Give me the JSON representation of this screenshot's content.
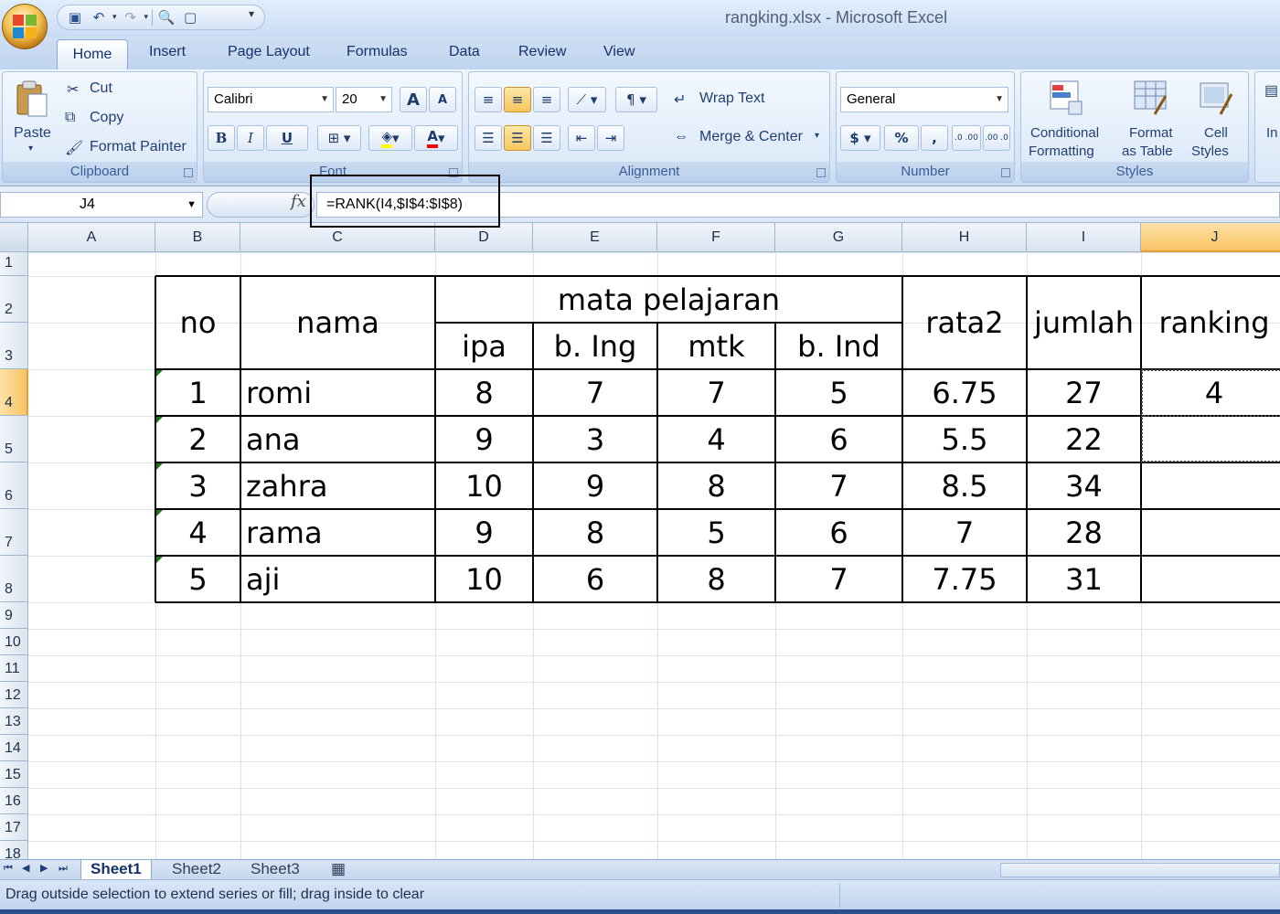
{
  "window": {
    "title": "rangking.xlsx - Microsoft Excel"
  },
  "quick_access": {
    "icons": [
      "save-icon",
      "undo-icon",
      "redo-icon",
      "print-preview-icon",
      "new-icon"
    ]
  },
  "ribbon_tabs": [
    "Home",
    "Insert",
    "Page Layout",
    "Formulas",
    "Data",
    "Review",
    "View"
  ],
  "clipboard": {
    "paste": "Paste",
    "cut": "Cut",
    "copy": "Copy",
    "format_painter": "Format Painter",
    "group": "Clipboard"
  },
  "font": {
    "name": "Calibri",
    "size": "20",
    "grow": "A",
    "shrink": "A",
    "bold": "B",
    "italic": "I",
    "underline": "U",
    "group": "Font",
    "fill_color": "#ffff00",
    "font_color": "#ff0000"
  },
  "alignment": {
    "wrap": "Wrap Text",
    "merge": "Merge & Center",
    "group": "Alignment"
  },
  "number": {
    "format": "General",
    "currency": "$",
    "percent": "%",
    "comma": ",",
    "inc_decimal": ".0 .00",
    "dec_decimal": ".00 .0",
    "group": "Number"
  },
  "styles": {
    "conditional_1": "Conditional",
    "conditional_2": "Formatting",
    "format_table_1": "Format",
    "format_table_2": "as Table",
    "cell_styles_1": "Cell",
    "cell_styles_2": "Styles",
    "group": "Styles"
  },
  "cells": {
    "insert": "In"
  },
  "formula_bar": {
    "name_box": "J4",
    "fx": "fx",
    "formula": "=RANK(I4,$I$4:$I$8)"
  },
  "columns": [
    "A",
    "B",
    "C",
    "D",
    "E",
    "F",
    "G",
    "H",
    "I",
    "J"
  ],
  "rows": [
    "1",
    "2",
    "3",
    "4",
    "5",
    "6",
    "7",
    "8",
    "9",
    "10",
    "11",
    "12",
    "13",
    "14",
    "15",
    "16",
    "17",
    "18"
  ],
  "table": {
    "headers": {
      "no": "no",
      "nama": "nama",
      "mata_pelajaran": "mata pelajaran",
      "rata2": "rata2",
      "jumlah": "jumlah",
      "ranking": "ranking"
    },
    "subjects": [
      "ipa",
      "b. Ing",
      "mtk",
      "b. Ind"
    ],
    "data": [
      [
        "1",
        "romi",
        "8",
        "7",
        "7",
        "5",
        "6.75",
        "27",
        "4"
      ],
      [
        "2",
        "ana",
        "9",
        "3",
        "4",
        "6",
        "5.5",
        "22",
        ""
      ],
      [
        "3",
        "zahra",
        "10",
        "9",
        "8",
        "7",
        "8.5",
        "34",
        ""
      ],
      [
        "4",
        "rama",
        "9",
        "8",
        "5",
        "6",
        "7",
        "28",
        ""
      ],
      [
        "5",
        "aji",
        "10",
        "6",
        "8",
        "7",
        "7.75",
        "31",
        ""
      ]
    ]
  },
  "sheets": [
    "Sheet1",
    "Sheet2",
    "Sheet3"
  ],
  "status": {
    "message": "Drag outside selection to extend series or fill; drag inside to clear"
  }
}
